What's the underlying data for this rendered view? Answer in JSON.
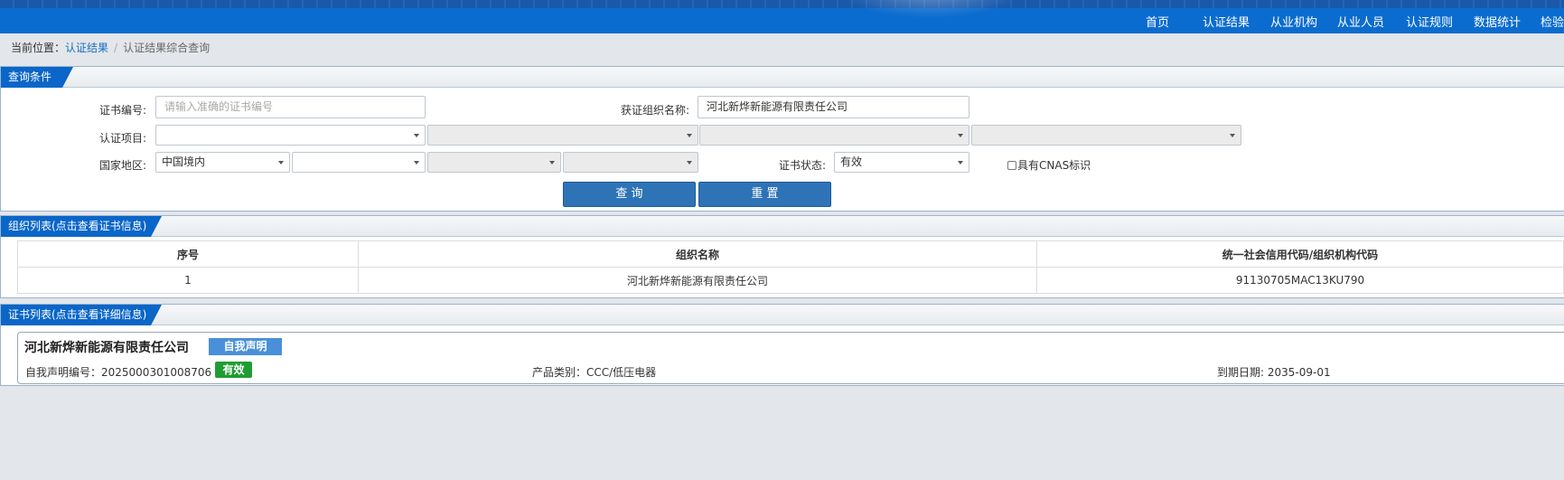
{
  "nav": {
    "items": [
      "首页",
      "认证结果",
      "从业机构",
      "从业人员",
      "认证规则",
      "数据统计",
      "检验"
    ]
  },
  "breadcrumb": {
    "prefix": "当前位置：",
    "link": "认证结果",
    "separator": "/",
    "current": "认证结果综合查询"
  },
  "query": {
    "title": "查询条件",
    "cert_no_label": "证书编号:",
    "cert_no_placeholder": "请输入准确的证书编号",
    "org_name_label": "获证组织名称:",
    "org_name_value": "河北新烨新能源有限责任公司",
    "project_label": "认证项目:",
    "region_label": "国家地区:",
    "region_value": "中国境内",
    "status_label": "证书状态:",
    "status_value": "有效",
    "cnas_label": "具有CNAS标识",
    "search_button": "查 询",
    "reset_button": "重 置"
  },
  "org_list": {
    "title": "组织列表(点击查看证书信息)",
    "columns": [
      "序号",
      "组织名称",
      "统一社会信用代码/组织机构代码"
    ],
    "rows": [
      [
        "1",
        "河北新烨新能源有限责任公司",
        "91130705MAC13KU790"
      ]
    ]
  },
  "cert_list": {
    "title": "证书列表(点击查看详细信息)",
    "items": [
      {
        "org_name": "河北新烨新能源有限责任公司",
        "type_badge": "自我声明",
        "decl_no": "自我声明编号：2025000301008706",
        "status_badge": "有效",
        "product": "产品类别：CCC/低压电器",
        "expiry": "到期日期: 2035-09-01"
      }
    ]
  },
  "colors": {
    "header_blue": "#0b6ccf",
    "panel_tab_blue": "#0a66c8",
    "button_blue": "#2f73b7",
    "badge_blue": "#4a90d9",
    "badge_green": "#1f9d34"
  }
}
